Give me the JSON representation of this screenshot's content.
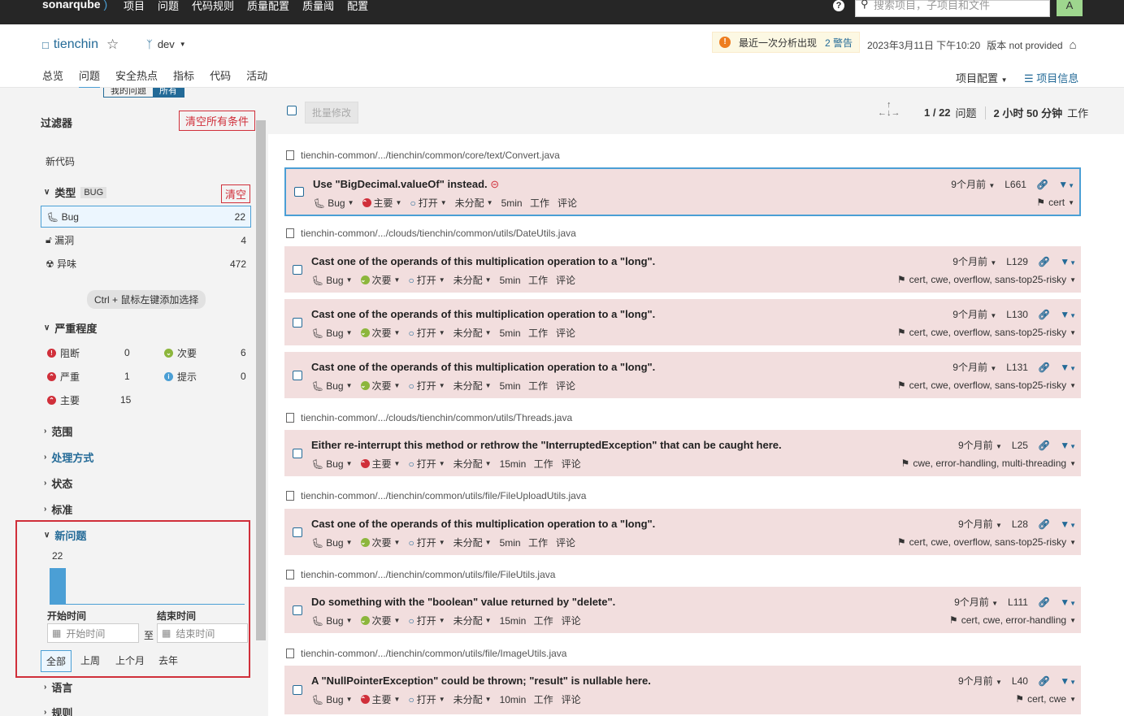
{
  "top": {
    "logo": "sonarqube",
    "nav": [
      "项目",
      "问题",
      "代码规则",
      "质量配置",
      "质量阈",
      "配置"
    ],
    "search_placeholder": "搜索项目，子项目和文件",
    "avatar": "A"
  },
  "project": {
    "name": "tienchin",
    "branch": "dev",
    "warning_text": "最近一次分析出现",
    "warning_link": "2 警告",
    "date": "2023年3月11日 下午10:20",
    "version": "版本 not provided",
    "tabs": [
      "总览",
      "问题",
      "安全热点",
      "指标",
      "代码",
      "活动"
    ],
    "config": "项目配置",
    "info": "项目信息"
  },
  "sidebar": {
    "seg_mine": "我的问题",
    "seg_all": "所有",
    "title": "过滤器",
    "clear_all": "清空所有条件",
    "new_code": "新代码",
    "type": {
      "label": "类型",
      "tag": "BUG",
      "clear": "清空",
      "items": [
        {
          "label": "Bug",
          "count": "22"
        },
        {
          "label": "漏洞",
          "count": "4"
        },
        {
          "label": "异味",
          "count": "472"
        }
      ]
    },
    "hint": "Ctrl + 鼠标左键添加选择",
    "severity": {
      "label": "严重程度",
      "items": [
        {
          "label": "阻断",
          "count": "0"
        },
        {
          "label": "次要",
          "count": "6"
        },
        {
          "label": "严重",
          "count": "1"
        },
        {
          "label": "提示",
          "count": "0"
        },
        {
          "label": "主要",
          "count": "15"
        }
      ]
    },
    "facets": [
      "范围",
      "处理方式",
      "状态",
      "标准"
    ],
    "new_issues": {
      "label": "新问题",
      "count": "22",
      "start_label": "开始时间",
      "end_label": "结束时间",
      "start_placeholder": "开始时间",
      "to": "至",
      "end_placeholder": "结束时间",
      "periods": [
        "全部",
        "上周",
        "上个月",
        "去年"
      ]
    },
    "more": [
      "语言",
      "规则"
    ]
  },
  "toolbar": {
    "bulk": "批量修改",
    "position": "1 / 22",
    "issues_label": "问题",
    "effort": "2 小时 50 分钟",
    "effort_label": "工作"
  },
  "issues_common": {
    "type": "Bug",
    "status": "打开",
    "assignee": "未分配",
    "work": "工作",
    "comment": "评论"
  },
  "files": [
    {
      "path": "tienchin-common/.../tienchin/common/core/text/Convert.java",
      "issues": [
        {
          "msg": "Use \"BigDecimal.valueOf\" instead.",
          "sev": "主要",
          "effort": "5min",
          "age": "9个月前",
          "line": "L661",
          "tags": "cert"
        }
      ]
    },
    {
      "path": "tienchin-common/.../clouds/tienchin/common/utils/DateUtils.java",
      "issues": [
        {
          "msg": "Cast one of the operands of this multiplication operation to a \"long\".",
          "sev": "次要",
          "effort": "5min",
          "age": "9个月前",
          "line": "L129",
          "tags": "cert, cwe, overflow, sans-top25-risky"
        },
        {
          "msg": "Cast one of the operands of this multiplication operation to a \"long\".",
          "sev": "次要",
          "effort": "5min",
          "age": "9个月前",
          "line": "L130",
          "tags": "cert, cwe, overflow, sans-top25-risky"
        },
        {
          "msg": "Cast one of the operands of this multiplication operation to a \"long\".",
          "sev": "次要",
          "effort": "5min",
          "age": "9个月前",
          "line": "L131",
          "tags": "cert, cwe, overflow, sans-top25-risky"
        }
      ]
    },
    {
      "path": "tienchin-common/.../clouds/tienchin/common/utils/Threads.java",
      "issues": [
        {
          "msg": "Either re-interrupt this method or rethrow the \"InterruptedException\" that can be caught here.",
          "sev": "主要",
          "effort": "15min",
          "age": "9个月前",
          "line": "L25",
          "tags": "cwe, error-handling, multi-threading"
        }
      ]
    },
    {
      "path": "tienchin-common/.../tienchin/common/utils/file/FileUploadUtils.java",
      "issues": [
        {
          "msg": "Cast one of the operands of this multiplication operation to a \"long\".",
          "sev": "次要",
          "effort": "5min",
          "age": "9个月前",
          "line": "L28",
          "tags": "cert, cwe, overflow, sans-top25-risky"
        }
      ]
    },
    {
      "path": "tienchin-common/.../tienchin/common/utils/file/FileUtils.java",
      "issues": [
        {
          "msg": "Do something with the \"boolean\" value returned by \"delete\".",
          "sev": "次要",
          "effort": "15min",
          "age": "9个月前",
          "line": "L111",
          "tags": "cert, cwe, error-handling"
        }
      ]
    },
    {
      "path": "tienchin-common/.../tienchin/common/utils/file/ImageUtils.java",
      "issues": [
        {
          "msg": "A \"NullPointerException\" could be thrown; \"result\" is nullable here.",
          "sev": "主要",
          "effort": "10min",
          "age": "9个月前",
          "line": "L40",
          "tags": "cert, cwe"
        }
      ]
    }
  ],
  "colors": {
    "accent": "#4b9fd5",
    "link": "#236a97",
    "issue_bg": "#f2dede",
    "major": "#d02f3a",
    "minor": "#8cb63c"
  }
}
